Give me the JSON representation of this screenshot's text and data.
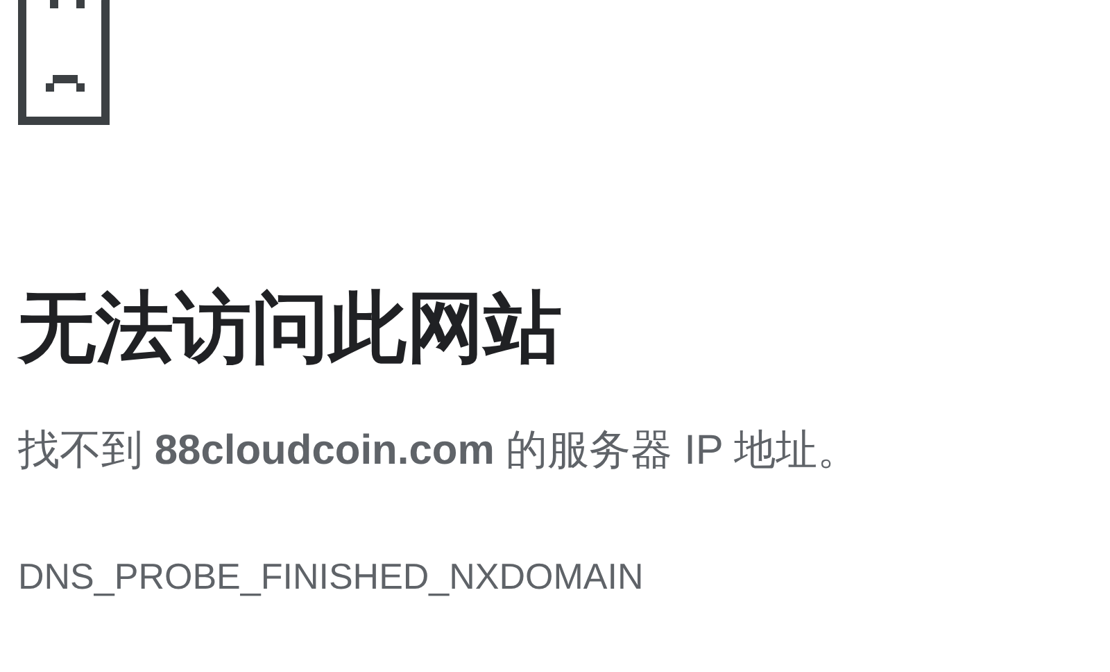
{
  "error": {
    "title": "无法访问此网站",
    "message": "找不到 **88cloudcoin.com** 的服务器 IP 地址。",
    "code": "DNS_PROBE_FINISHED_NXDOMAIN"
  }
}
